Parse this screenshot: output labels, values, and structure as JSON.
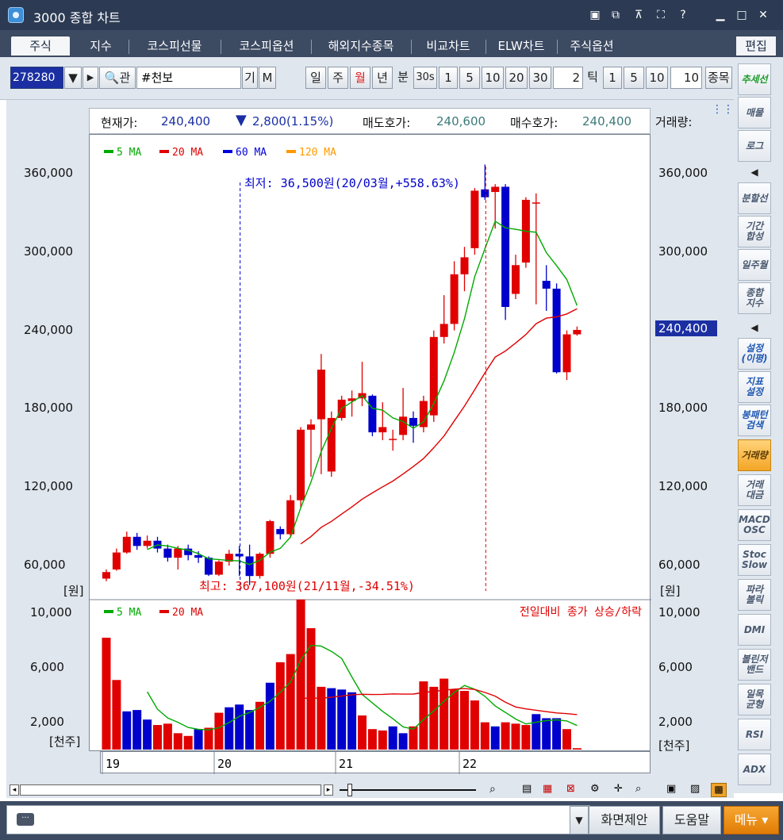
{
  "window": {
    "title": "3000 종합 차트"
  },
  "tabs": [
    "주식",
    "지수",
    "코스피선물",
    "코스피옵션",
    "해외지수종목",
    "비교차트",
    "ELW차트",
    "주식옵션"
  ],
  "edit_label": "편집",
  "toolbar": {
    "code": "278280",
    "search_label": "관",
    "name": "#천보",
    "gi": "기",
    "m": "M",
    "periods": [
      "일",
      "주",
      "월",
      "년",
      "분"
    ],
    "active_period": "월",
    "minute_buttons": [
      "30s",
      "1",
      "5",
      "10",
      "20",
      "30"
    ],
    "minute_input": "2",
    "tick_label": "틱",
    "tick_buttons": [
      "1",
      "5",
      "10"
    ],
    "tick_input": "10",
    "jong_label": "종목"
  },
  "quote": {
    "current_label": "현재가:",
    "current": "240,400",
    "change": "2,800(1.15%)",
    "ask_label": "매도호가:",
    "ask": "240,600",
    "bid_label": "매수호가:",
    "bid": "240,400",
    "volume_label": "거래량:"
  },
  "price_chart": {
    "legend": [
      {
        "name": "5 MA",
        "color": "#00aa00"
      },
      {
        "name": "20 MA",
        "color": "#e00000"
      },
      {
        "name": "60 MA",
        "color": "#0000dd"
      },
      {
        "name": "120 MA",
        "color": "#ff9900"
      }
    ],
    "y_ticks": [
      "360,000",
      "300,000",
      "240,000",
      "180,000",
      "120,000",
      "60,000"
    ],
    "y_unit": "[원]",
    "current_price_tag": "240,400",
    "annotation_low": "최저: 36,500원(20/03월,+558.63%)",
    "annotation_high": "최고: 367,100원(21/11월,-34.51%)"
  },
  "volume_chart": {
    "legend": [
      {
        "name": "5 MA",
        "color": "#00aa00"
      },
      {
        "name": "20 MA",
        "color": "#e00000"
      }
    ],
    "note": "전일대비 종가 상승/하락",
    "y_ticks": [
      "10,000",
      "6,000",
      "2,000"
    ],
    "y_unit": "[천주]"
  },
  "x_ticks": [
    "19",
    "20",
    "21",
    "22"
  ],
  "right_panel": [
    {
      "label": "추세선",
      "style": "green"
    },
    {
      "label": "매물",
      "style": ""
    },
    {
      "label": "로그",
      "style": ""
    },
    {
      "label": "분할선",
      "style": ""
    },
    {
      "label": "기간\n합성",
      "style": ""
    },
    {
      "label": "일주월",
      "style": ""
    },
    {
      "label": "종합\n지수",
      "style": ""
    },
    {
      "label": "설정\n(이평)",
      "style": "blue"
    },
    {
      "label": "지표\n설정",
      "style": "blue"
    },
    {
      "label": "봉패턴\n검색",
      "style": "blue"
    },
    {
      "label": "거래량",
      "style": "active"
    },
    {
      "label": "거래\n대금",
      "style": ""
    },
    {
      "label": "MACD\nOSC",
      "style": ""
    },
    {
      "label": "Stoc\nSlow",
      "style": ""
    },
    {
      "label": "파라\n볼릭",
      "style": ""
    },
    {
      "label": "DMI",
      "style": ""
    },
    {
      "label": "볼린저\n밴드",
      "style": ""
    },
    {
      "label": "일목\n균형",
      "style": ""
    },
    {
      "label": "RSI",
      "style": ""
    },
    {
      "label": "ADX",
      "style": ""
    }
  ],
  "status": {
    "screen_limit": "화면제안",
    "help": "도움말",
    "menu": "메뉴"
  },
  "chart_data": {
    "type": "candlestick",
    "price": {
      "ylim": [
        45000,
        375000
      ],
      "candles": [
        [
          50000,
          55000,
          48000,
          57000
        ],
        [
          57000,
          70000,
          56000,
          73000
        ],
        [
          70000,
          82000,
          69000,
          86000
        ],
        [
          82000,
          75000,
          72000,
          85000
        ],
        [
          75000,
          79000,
          73000,
          83000
        ],
        [
          79000,
          73000,
          70000,
          82000
        ],
        [
          73000,
          66000,
          63000,
          76000
        ],
        [
          66000,
          73000,
          57000,
          75000
        ],
        [
          73000,
          68000,
          64000,
          76000
        ],
        [
          68000,
          66000,
          62000,
          71000
        ],
        [
          66000,
          53000,
          52000,
          67000
        ],
        [
          53000,
          63000,
          52000,
          64000
        ],
        [
          63000,
          69000,
          60000,
          72000
        ],
        [
          69000,
          67000,
          52000,
          75000
        ],
        [
          67000,
          52000,
          45000,
          76000
        ],
        [
          52000,
          69000,
          50000,
          70000
        ],
        [
          69000,
          94000,
          66000,
          95000
        ],
        [
          88000,
          84000,
          80000,
          90000
        ],
        [
          84000,
          110000,
          82000,
          114000
        ],
        [
          110000,
          164000,
          104000,
          166000
        ],
        [
          164000,
          168000,
          128000,
          172000
        ],
        [
          172000,
          210000,
          130000,
          222000
        ],
        [
          132000,
          173000,
          128000,
          178000
        ],
        [
          173000,
          187000,
          171000,
          190000
        ],
        [
          186000,
          188000,
          174000,
          194000
        ],
        [
          188000,
          192000,
          182000,
          216000
        ],
        [
          190000,
          162000,
          159000,
          191000
        ],
        [
          162000,
          166000,
          156000,
          185000
        ],
        [
          157000,
          157000,
          148000,
          164000
        ],
        [
          160000,
          174000,
          156000,
          196000
        ],
        [
          173000,
          167000,
          154000,
          178000
        ],
        [
          166000,
          186000,
          162000,
          190000
        ],
        [
          175000,
          235000,
          170000,
          240000
        ],
        [
          235000,
          245000,
          230000,
          267000
        ],
        [
          245000,
          283000,
          240000,
          293000
        ],
        [
          283000,
          296000,
          270000,
          304000
        ],
        [
          303000,
          347000,
          298000,
          349000
        ],
        [
          348000,
          342000,
          340000,
          367000
        ],
        [
          346000,
          350000,
          318000,
          352000
        ],
        [
          350000,
          258000,
          248000,
          352000
        ],
        [
          268000,
          290000,
          264000,
          298000
        ],
        [
          292000,
          340000,
          288000,
          342000
        ],
        [
          338000,
          338000,
          260000,
          345000
        ],
        [
          278000,
          272000,
          255000,
          290000
        ],
        [
          272000,
          208000,
          207000,
          276000
        ],
        [
          208000,
          237000,
          202000,
          240000
        ],
        [
          237000,
          240400,
          236000,
          243000
        ]
      ]
    },
    "volume": {
      "ylim": [
        0,
        11000
      ],
      "values": [
        8200,
        5100,
        2800,
        2900,
        2200,
        1800,
        1900,
        1200,
        1000,
        1500,
        1600,
        2700,
        3100,
        3300,
        2900,
        3500,
        4900,
        6400,
        7000,
        11000,
        8900,
        4600,
        4500,
        4400,
        4200,
        2500,
        1500,
        1400,
        1700,
        1200,
        1700,
        5000,
        4600,
        5200,
        4400,
        4300,
        3600,
        2000,
        1700,
        2000,
        1900,
        1800,
        2600,
        2300,
        2300,
        1500,
        100
      ],
      "colors": [
        "r",
        "r",
        "b",
        "b",
        "b",
        "r",
        "r",
        "r",
        "r",
        "b",
        "r",
        "r",
        "b",
        "b",
        "b",
        "r",
        "b",
        "r",
        "r",
        "r",
        "r",
        "r",
        "b",
        "b",
        "b",
        "r",
        "r",
        "r",
        "b",
        "b",
        "r",
        "r",
        "r",
        "r",
        "r",
        "r",
        "r",
        "r",
        "b",
        "r",
        "r",
        "r",
        "b",
        "b",
        "b",
        "r",
        "r"
      ]
    },
    "x_ticks": [
      "19",
      "20",
      "21",
      "22"
    ]
  }
}
